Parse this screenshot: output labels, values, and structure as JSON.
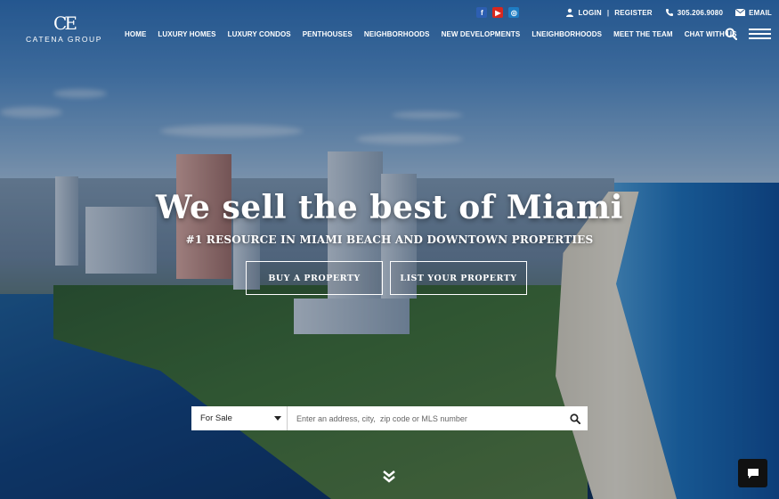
{
  "brand": {
    "mark": "CE",
    "name": "CATENA GROUP"
  },
  "social": {
    "facebook": "f",
    "youtube": "▶",
    "instagram": "◎"
  },
  "utility": {
    "login": "LOGIN",
    "separator": "|",
    "register": "REGISTER",
    "phone": "305.206.9080",
    "email": "EMAIL"
  },
  "nav": [
    "HOME",
    "LUXURY HOMES",
    "LUXURY CONDOS",
    "PENTHOUSES",
    "NEIGHBORHOODS",
    "NEW DEVELOPMENTS",
    "LNEIGHBORHOODS",
    "MEET THE TEAM",
    "CHAT WITH US"
  ],
  "hero": {
    "title": "We sell the best of Miami",
    "subtitle": "#1 RESOURCE IN MIAMI BEACH AND DOWNTOWN PROPERTIES",
    "buy_label": "BUY A PROPERTY",
    "list_label": "LIST YOUR PROPERTY"
  },
  "search": {
    "mode": "For Sale",
    "placeholder": "Enter an address, city,  zip code or MLS number"
  },
  "icons": [
    "facebook-icon",
    "youtube-icon",
    "instagram-icon",
    "user-icon",
    "phone-icon",
    "mail-icon",
    "search-icon",
    "menu-icon",
    "chevron-double-down-icon",
    "chat-icon"
  ]
}
